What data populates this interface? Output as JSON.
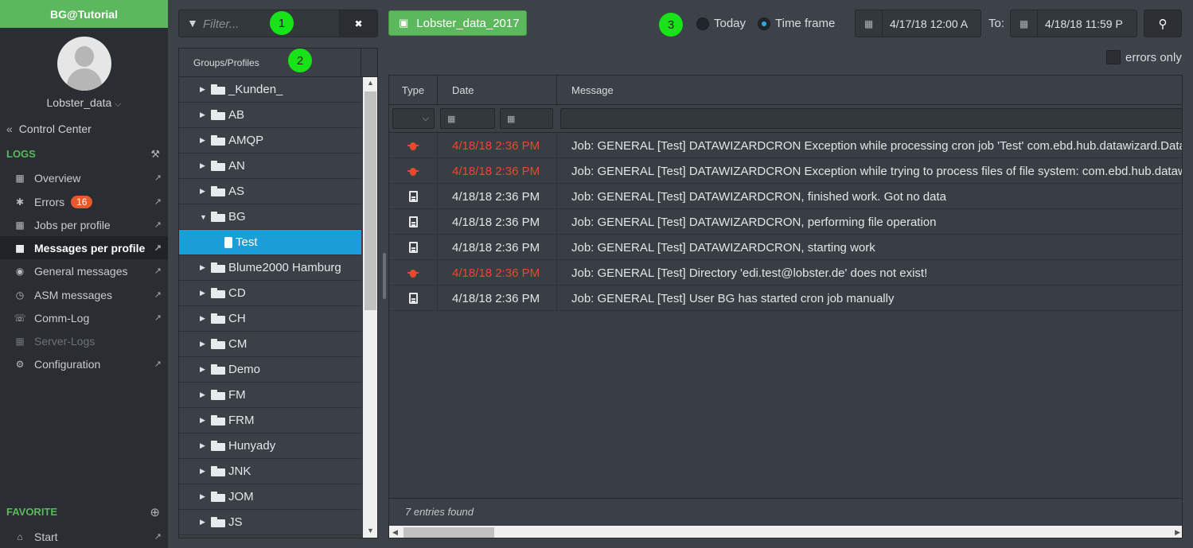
{
  "brand": "BG@Tutorial",
  "user": "Lobster_data",
  "control_center": "Control Center",
  "sections": {
    "logs": "LOGS",
    "favorite": "FAVORITE"
  },
  "nav": [
    {
      "label": "Overview",
      "icon": "document-icon"
    },
    {
      "label": "Errors",
      "icon": "bug-icon",
      "badge": "16"
    },
    {
      "label": "Jobs per profile",
      "icon": "document-icon"
    },
    {
      "label": "Messages per profile",
      "icon": "document-icon"
    },
    {
      "label": "General messages",
      "icon": "globe-icon"
    },
    {
      "label": "ASM messages",
      "icon": "clock-icon"
    },
    {
      "label": "Comm-Log",
      "icon": "comm-icon"
    },
    {
      "label": "Server-Logs",
      "icon": "document-icon"
    },
    {
      "label": "Configuration",
      "icon": "gears-icon"
    }
  ],
  "favorites": [
    {
      "label": "Start",
      "icon": "home-icon"
    }
  ],
  "filter": {
    "placeholder": "Filter..."
  },
  "markers": [
    "1",
    "2",
    "3"
  ],
  "profile_button": "Lobster_data_2017",
  "range": {
    "today": "Today",
    "time_frame": "Time frame",
    "selected": "Time frame"
  },
  "date_from": "4/17/18 12:00 A",
  "to_label": "To:",
  "date_to": "4/18/18 11:59 P",
  "errors_only": "errors only",
  "tree": {
    "header": "Groups/Profiles",
    "items": [
      {
        "label": "_Kunden_",
        "type": "folder"
      },
      {
        "label": "AB",
        "type": "folder"
      },
      {
        "label": "AMQP",
        "type": "folder"
      },
      {
        "label": "AN",
        "type": "folder"
      },
      {
        "label": "AS",
        "type": "folder"
      },
      {
        "label": "BG",
        "type": "folder-open"
      },
      {
        "label": "Test",
        "type": "profile",
        "selected": true
      },
      {
        "label": "Blume2000 Hamburg",
        "type": "folder"
      },
      {
        "label": "CD",
        "type": "folder"
      },
      {
        "label": "CH",
        "type": "folder"
      },
      {
        "label": "CM",
        "type": "folder"
      },
      {
        "label": "Demo",
        "type": "folder"
      },
      {
        "label": "FM",
        "type": "folder"
      },
      {
        "label": "FRM",
        "type": "folder"
      },
      {
        "label": "Hunyady",
        "type": "folder"
      },
      {
        "label": "JNK",
        "type": "folder"
      },
      {
        "label": "JOM",
        "type": "folder"
      },
      {
        "label": "JS",
        "type": "folder"
      }
    ]
  },
  "grid": {
    "columns": [
      "Type",
      "Date",
      "Message"
    ],
    "rows": [
      {
        "type": "error",
        "date": "4/18/18 2:36 PM",
        "message": "Job: GENERAL [Test] DATAWIZARDCRON Exception while processing cron job 'Test' com.ebd.hub.datawizard.DataRe"
      },
      {
        "type": "error",
        "date": "4/18/18 2:36 PM",
        "message": "Job: GENERAL [Test] DATAWIZARDCRON Exception while trying to process files of file system: com.ebd.hub.datawiza"
      },
      {
        "type": "info",
        "date": "4/18/18 2:36 PM",
        "message": "Job: GENERAL [Test] DATAWIZARDCRON, finished work. Got no data"
      },
      {
        "type": "info",
        "date": "4/18/18 2:36 PM",
        "message": "Job: GENERAL [Test] DATAWIZARDCRON, performing file operation"
      },
      {
        "type": "info",
        "date": "4/18/18 2:36 PM",
        "message": "Job: GENERAL [Test] DATAWIZARDCRON, starting work"
      },
      {
        "type": "error",
        "date": "4/18/18 2:36 PM",
        "message": "Job: GENERAL [Test] Directory 'edi.test@lobster.de' does not exist!"
      },
      {
        "type": "info",
        "date": "4/18/18 2:36 PM",
        "message": "Job: GENERAL [Test] User BG has started cron job manually"
      }
    ],
    "footer": "7 entries found"
  },
  "colors": {
    "accent_green": "#5cb85c",
    "selection_blue": "#1a9ed8",
    "error_red": "#e8492f",
    "marker_green": "#18e218"
  }
}
